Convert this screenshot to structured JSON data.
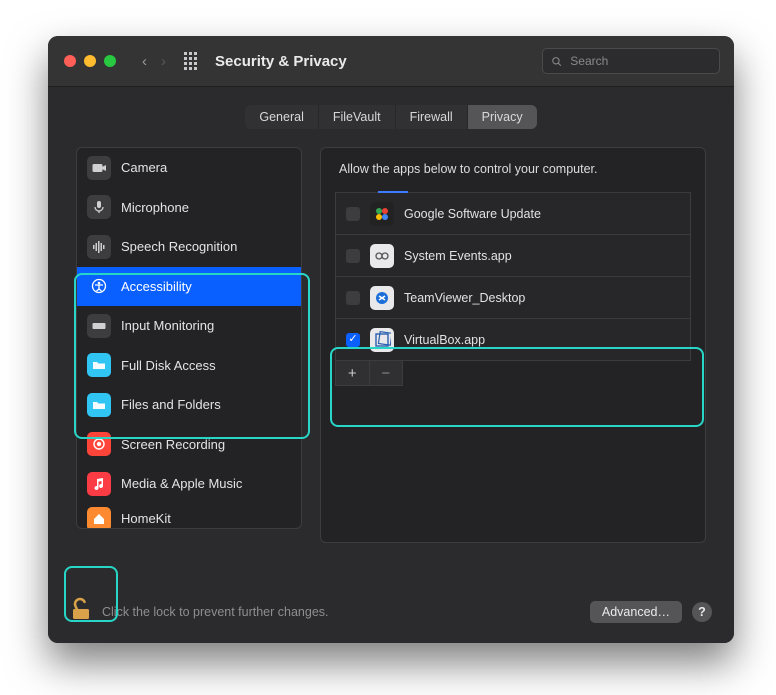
{
  "window": {
    "title": "Security & Privacy"
  },
  "search": {
    "placeholder": "Search"
  },
  "tabs": {
    "general": "General",
    "filevault": "FileVault",
    "firewall": "Firewall",
    "privacy": "Privacy"
  },
  "sidebar": {
    "items": [
      {
        "label": "Camera"
      },
      {
        "label": "Microphone"
      },
      {
        "label": "Speech Recognition"
      },
      {
        "label": "Accessibility"
      },
      {
        "label": "Input Monitoring"
      },
      {
        "label": "Full Disk Access"
      },
      {
        "label": "Files and Folders"
      },
      {
        "label": "Screen Recording"
      },
      {
        "label": "Media & Apple Music"
      },
      {
        "label": "HomeKit"
      }
    ]
  },
  "panel": {
    "description": "Allow the apps below to control your computer.",
    "apps": [
      {
        "name": "Google Software Update",
        "checked": false
      },
      {
        "name": "System Events.app",
        "checked": false
      },
      {
        "name": "TeamViewer_Desktop",
        "checked": false
      },
      {
        "name": "VirtualBox.app",
        "checked": true
      }
    ],
    "add": "+",
    "remove": "−"
  },
  "footer": {
    "lock_hint": "Click the lock to prevent further changes.",
    "advanced": "Advanced…",
    "help": "?"
  }
}
